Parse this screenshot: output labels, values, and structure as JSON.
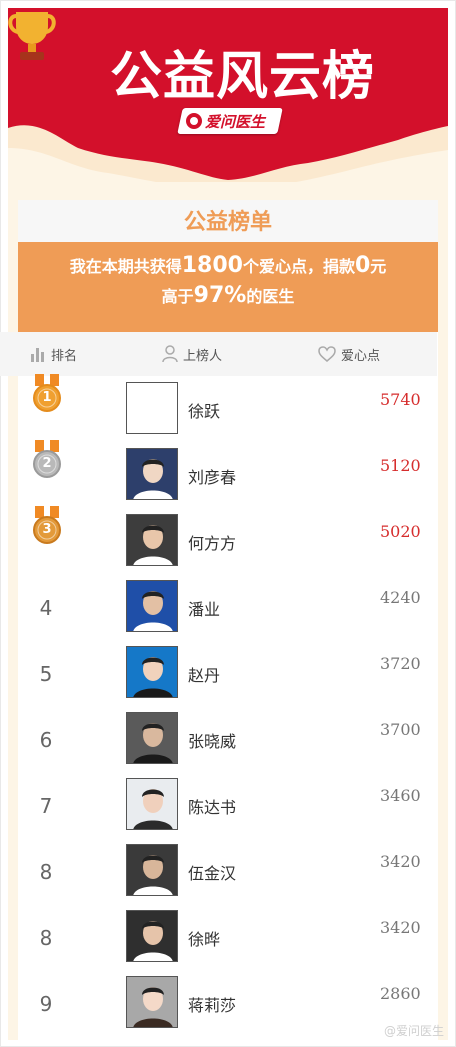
{
  "banner": {
    "title": "公益风云榜",
    "brand": "爱问医生"
  },
  "list_title": "公益榜单",
  "summary": {
    "line1_a": "我在本期共获得",
    "points": "1800",
    "line1_b": "个爱心点，捐款",
    "donation": "0",
    "line1_c": "元",
    "line2_a": "高于",
    "percent": "97%",
    "line2_b": "的医生"
  },
  "columns": {
    "rank": "排名",
    "name": "上榜人",
    "points": "爱心点"
  },
  "rows": [
    {
      "rank": "1",
      "name": "徐跃",
      "points": "5740",
      "medal": "gold"
    },
    {
      "rank": "2",
      "name": "刘彦春",
      "points": "5120",
      "medal": "silver"
    },
    {
      "rank": "3",
      "name": "何方方",
      "points": "5020",
      "medal": "bronze"
    },
    {
      "rank": "4",
      "name": "潘业",
      "points": "4240",
      "medal": ""
    },
    {
      "rank": "5",
      "name": "赵丹",
      "points": "3720",
      "medal": ""
    },
    {
      "rank": "6",
      "name": "张晓威",
      "points": "3700",
      "medal": ""
    },
    {
      "rank": "7",
      "name": "陈达书",
      "points": "3460",
      "medal": ""
    },
    {
      "rank": "8",
      "name": "伍金汉",
      "points": "3420",
      "medal": ""
    },
    {
      "rank": "8",
      "name": "徐晔",
      "points": "3420",
      "medal": ""
    },
    {
      "rank": "9",
      "name": "蒋莉莎",
      "points": "2860",
      "medal": ""
    }
  ],
  "watermark": "@爱问医生",
  "colors": {
    "banner_red": "#d3102b",
    "accent_orange": "#ef9c56",
    "top_points_red": "#d62d2d"
  }
}
